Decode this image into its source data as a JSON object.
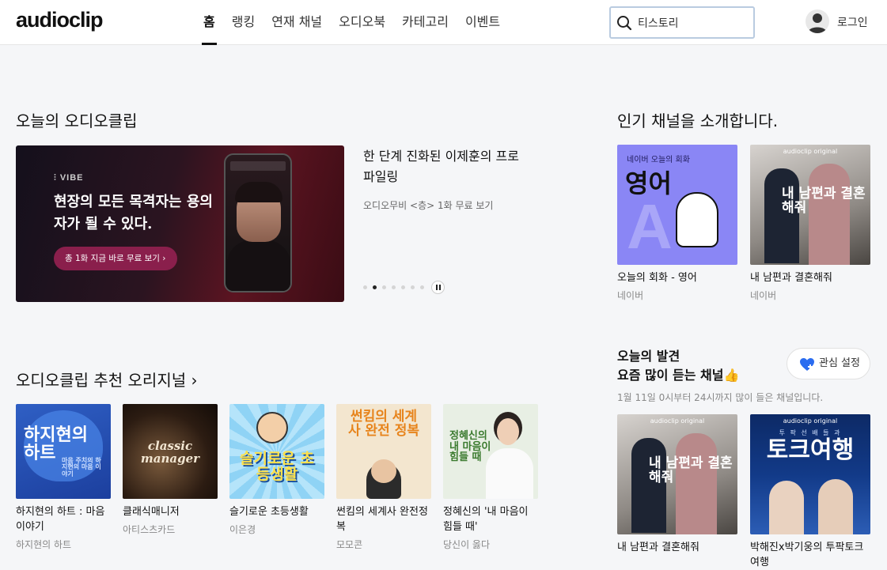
{
  "header": {
    "logo": "audioclip",
    "nav": [
      "홈",
      "랭킹",
      "연재 채널",
      "오디오북",
      "카테고리",
      "이벤트"
    ],
    "search_value": "티스토리",
    "login_label": "로그인"
  },
  "today": {
    "title": "오늘의 오디오클립",
    "banner": {
      "brand": "VIBE",
      "headline": "현장의 모든 목격자는 용의자가 될 수 있다.",
      "cta": "총 1화 지금 바로 무료 보기 ›"
    },
    "info_title": "한 단계 진화된 이제훈의 프로파일링",
    "info_sub": "오디오무비 <층> 1화 무료 보기",
    "dots_total": 7,
    "dots_active": 2
  },
  "recommend": {
    "title": "오디오클립 추천 오리지널",
    "arrow": "›",
    "items": [
      {
        "title": "하지현의 하트 : 마음 이야기",
        "sub": "하지현의 하트",
        "thumb_text": "하지현의 하트",
        "thumb_sub": "마음 주치의 하지현의 마음 이야기"
      },
      {
        "title": "클래식매니저",
        "sub": "아티스츠카드",
        "thumb_text": "classic manager"
      },
      {
        "title": "슬기로운 초등생활",
        "sub": "이은경",
        "thumb_text": "슬기로운 초등생활"
      },
      {
        "title": "썬킴의 세계사 완전정복",
        "sub": "모모콘",
        "thumb_text": "썬킴의 세계사 완전 정복"
      },
      {
        "title": "정혜신의 '내 마음이 힘들 때'",
        "sub": "당신이 옳다",
        "thumb_text": "정혜신의 내 마음이 힘들 때"
      }
    ]
  },
  "popular": {
    "title": "인기 채널을 소개합니다.",
    "items": [
      {
        "title": "오늘의 회화 - 영어",
        "sub": "네이버",
        "thumb_top": "네이버 오늘의 회화",
        "thumb_text": "영어",
        "thumb_letter": "A"
      },
      {
        "title": "내 남편과 결혼해줘",
        "sub": "네이버",
        "thumb_top": "audioclip original",
        "thumb_text": "내 남편과 결혼해줘"
      }
    ]
  },
  "discover": {
    "title_line1": "오늘의 발견",
    "title_line2": "요즘 많이 듣는 채널👍",
    "interest_label": "관심 설정",
    "desc": "1월 11일 0시부터 24시까지 많이 들은 채널입니다.",
    "items": [
      {
        "title": "내 남편과 결혼해줘",
        "thumb_top": "audioclip original",
        "thumb_text": "내 남편과 결혼해줘"
      },
      {
        "title": "박해진x박기웅의 투팍토크여행",
        "thumb_top": "audioclip original",
        "thumb_text": "토크여행",
        "thumb_small": "투 팍 선 배 들 과"
      }
    ]
  }
}
